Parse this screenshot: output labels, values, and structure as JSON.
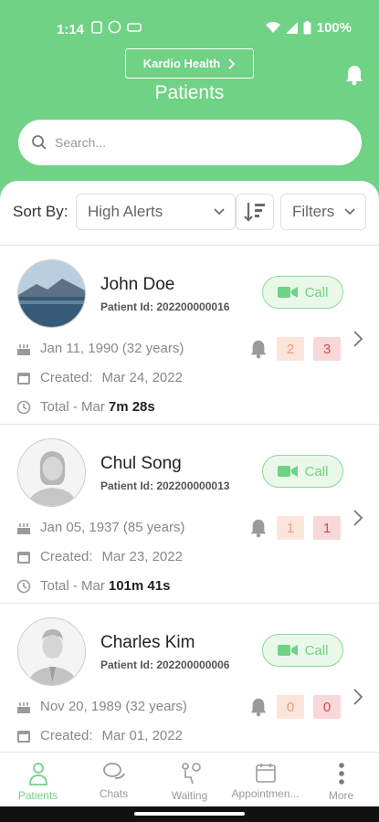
{
  "status_bar": {
    "time": "1:14",
    "battery": "100%"
  },
  "header": {
    "brand_button": "Kardio Health",
    "title": "Patients"
  },
  "search": {
    "placeholder": "Search..."
  },
  "sort": {
    "label": "Sort By:",
    "selected": "High Alerts",
    "filters_label": "Filters"
  },
  "patients": [
    {
      "name": "John Doe",
      "patient_id": "Patient Id: 202200000016",
      "call_label": "Call",
      "dob": "Jan 11, 1990 (32 years)",
      "created_label": "Created:",
      "created_date": "Mar 24, 2022",
      "total_label": "Total - Mar",
      "total_value": "7m 28s",
      "alert_medium": "2",
      "alert_high": "3"
    },
    {
      "name": "Chul Song",
      "patient_id": "Patient Id: 202200000013",
      "call_label": "Call",
      "dob": "Jan 05, 1937 (85 years)",
      "created_label": "Created:",
      "created_date": "Mar 23, 2022",
      "total_label": "Total - Mar",
      "total_value": "101m 41s",
      "alert_medium": "1",
      "alert_high": "1"
    },
    {
      "name": "Charles Kim",
      "patient_id": "Patient Id: 202200000006",
      "call_label": "Call",
      "dob": "Nov 20, 1989 (32 years)",
      "created_label": "Created:",
      "created_date": "Mar 01, 2022",
      "alert_medium": "0",
      "alert_high": "0"
    }
  ],
  "nav": {
    "patients": "Patients",
    "chats": "Chats",
    "waiting": "Waiting",
    "appointments": "Appointmen...",
    "more": "More"
  },
  "colors": {
    "brand_green": "#6fd285",
    "badge_orange": "#fbe5db",
    "badge_red": "#f8d7d9"
  }
}
